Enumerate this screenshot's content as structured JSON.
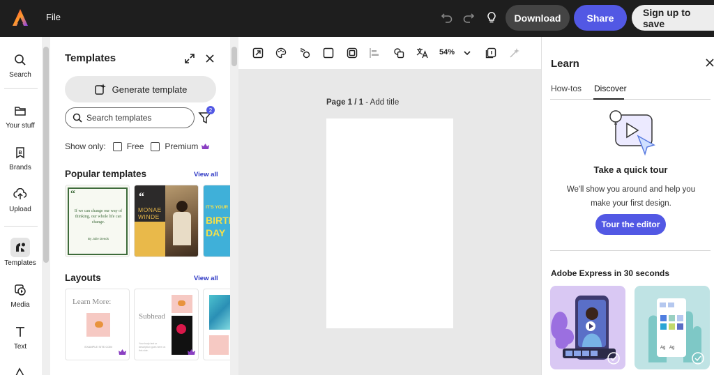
{
  "topbar": {
    "file_label": "File",
    "download_label": "Download",
    "share_label": "Share",
    "signup_label": "Sign up to save",
    "icons": [
      "undo-icon",
      "redo-icon",
      "lightbulb-icon"
    ]
  },
  "rail": {
    "items": [
      {
        "label": "Search",
        "icon": "search-icon"
      },
      {
        "label": "Your stuff",
        "icon": "folder-icon"
      },
      {
        "label": "Brands",
        "icon": "brand-icon"
      },
      {
        "label": "Upload",
        "icon": "upload-icon"
      },
      {
        "label": "Templates",
        "icon": "templates-icon",
        "active": true
      },
      {
        "label": "Media",
        "icon": "media-icon"
      },
      {
        "label": "Text",
        "icon": "text-icon"
      }
    ]
  },
  "panel": {
    "title": "Templates",
    "generate_label": "Generate template",
    "search_placeholder": "Search templates",
    "filter_count": "2",
    "show_only_label": "Show only:",
    "free_label": "Free",
    "premium_label": "Premium",
    "popular_title": "Popular templates",
    "layouts_title": "Layouts",
    "view_all_label": "View all",
    "popular": [
      {
        "quote": "If we can change our way of thinking, our whole life can change.",
        "author": "By Julie Deeds"
      },
      {
        "line1": "MONAE",
        "line2": "WINDE"
      },
      {
        "line1": "IT'S YOUR",
        "line2": "BIRTH",
        "line3": "DAY"
      }
    ],
    "layouts": [
      {
        "heading": "Learn More:",
        "footer": "EXAMPLE SITE.COM"
      },
      {
        "heading": "Subhead",
        "body": "Your body text or description goes here on this side."
      }
    ]
  },
  "canvas": {
    "zoom": "54%",
    "page_label": "Page 1 / 1",
    "page_title_placeholder": "Add title"
  },
  "learn": {
    "title": "Learn",
    "tabs": [
      "How-tos",
      "Discover"
    ],
    "active_tab": "Discover",
    "tour_title": "Take a quick tour",
    "tour_desc": "We'll show you around and help you make your first design.",
    "tour_button": "Tour the editor",
    "video_title": "Adobe Express in 30 seconds",
    "card_labels": [
      "Ag",
      "Ag"
    ]
  },
  "colors": {
    "accent": "#5258e4",
    "topbar_bg": "#1e1e1e",
    "premium_crown": "#8a3fc2"
  }
}
